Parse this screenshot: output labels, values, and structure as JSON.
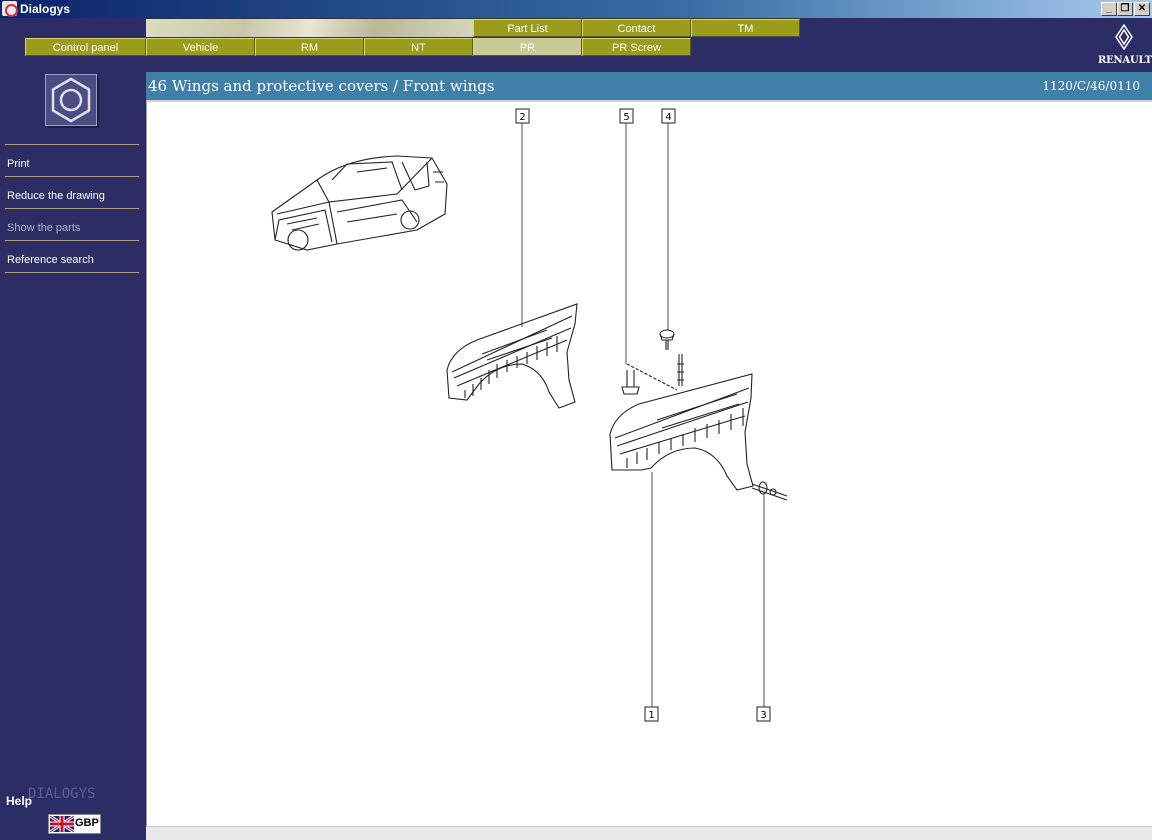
{
  "window": {
    "title": "Dialogys"
  },
  "tabs_top": [
    {
      "label": "Part List"
    },
    {
      "label": "Contact"
    },
    {
      "label": "TM"
    }
  ],
  "tabs_bottom": [
    {
      "label": "Control panel"
    },
    {
      "label": "Vehicle"
    },
    {
      "label": "RM"
    },
    {
      "label": "NT"
    },
    {
      "label": "PR",
      "active": true
    },
    {
      "label": "PR Screw"
    }
  ],
  "brand": {
    "name": "RENAULT"
  },
  "sidebar": {
    "icon": "hexagon-nut-icon",
    "items": [
      {
        "label": "Print",
        "enabled": true
      },
      {
        "label": "Reduce the drawing",
        "enabled": true
      },
      {
        "label": "Show the parts",
        "enabled": false
      },
      {
        "label": "Reference search",
        "enabled": true
      }
    ],
    "help_label": "Help",
    "watermark": "DIALOGYS",
    "currency": "GBP"
  },
  "section": {
    "title": "46 Wings and protective covers / Front wings",
    "reference": "1120/C/46/0110"
  },
  "callouts": [
    "2",
    "5",
    "4",
    "1",
    "3"
  ],
  "colors": {
    "sidebar_bg": "#2b2d64",
    "tab_olive": "#9c9c1c",
    "tab_active": "#c9c997",
    "section_header": "#3f7fa8",
    "menu_divider": "#b8a832"
  }
}
